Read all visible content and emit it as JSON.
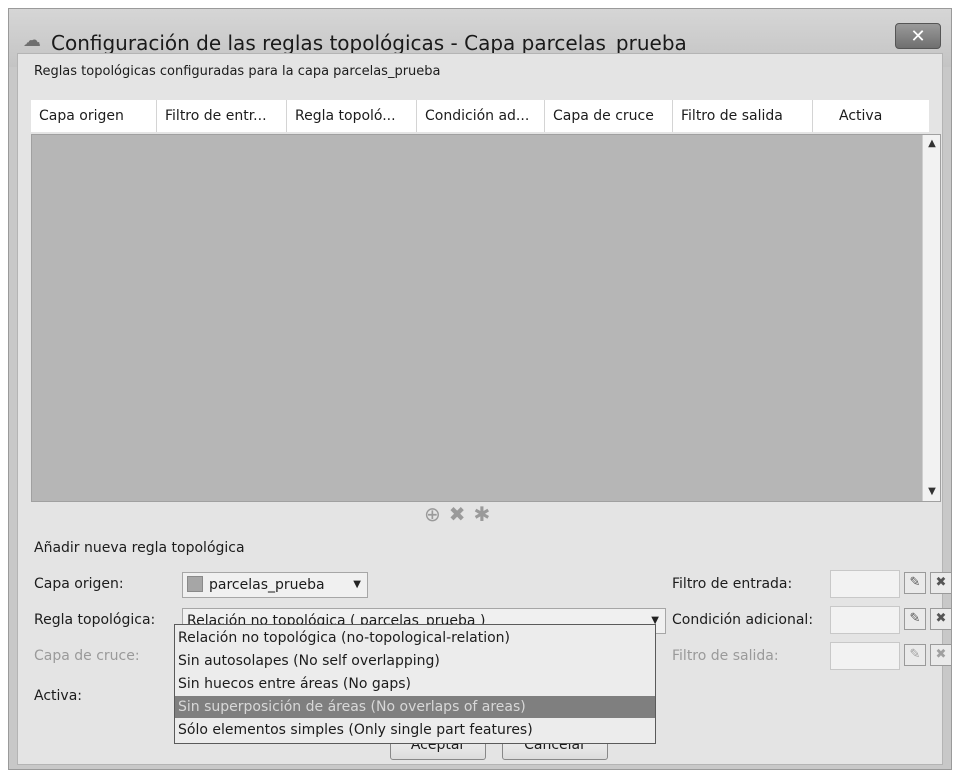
{
  "window": {
    "title": "Configuración de las reglas topológicas - Capa parcelas_prueba",
    "close_label": "✕"
  },
  "rules_section": {
    "label": "Reglas topológicas configuradas para la capa parcelas_prueba",
    "columns": [
      "Capa origen",
      "Filtro de entr...",
      "Regla topoló...",
      "Condición ad...",
      "Capa de cruce",
      "Filtro de salida",
      "Activa"
    ]
  },
  "toolbar": {
    "add_icon": "add-icon",
    "remove_icon": "remove-icon",
    "settings_icon": "puzzle-icon"
  },
  "new_rule": {
    "section_label": "Añadir nueva regla topológica",
    "origin_layer_label": "Capa origen:",
    "origin_layer_value": "parcelas_prueba",
    "rule_label": "Regla topológica:",
    "rule_value": "Relación no topológica ( parcelas_prueba )",
    "cross_layer_label": "Capa de cruce:",
    "active_label": "Activa:",
    "input_filter_label": "Filtro de entrada:",
    "additional_condition_label": "Condición adicional:",
    "output_filter_label": "Filtro de salida:"
  },
  "rule_options": [
    "Relación no topológica (no-topological-relation)",
    "Sin autosolapes (No self overlapping)",
    "Sin huecos entre áreas (No gaps)",
    "Sin superposición de áreas (No overlaps of areas)",
    "Sólo elementos simples (Only single part features)"
  ],
  "buttons": {
    "accept": "Aceptar",
    "cancel": "Cancelar"
  }
}
